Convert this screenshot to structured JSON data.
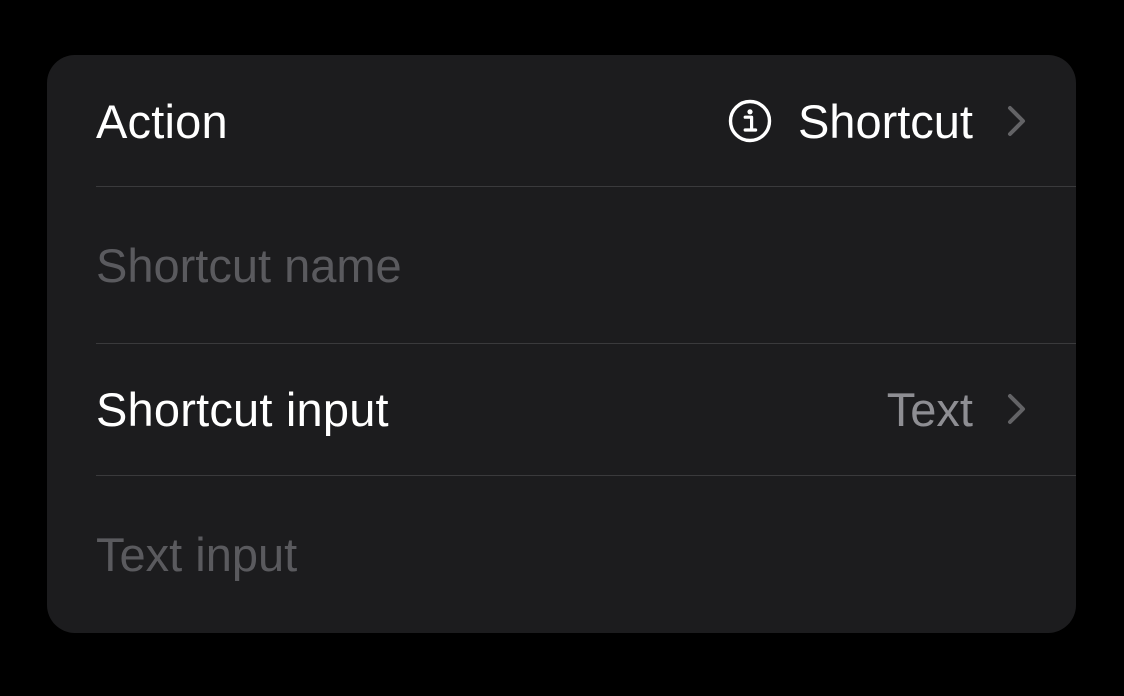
{
  "action_row": {
    "label": "Action",
    "value": "Shortcut",
    "info_icon": "info-circle-icon",
    "chevron_icon": "chevron-right-icon"
  },
  "shortcut_name_field": {
    "placeholder": "Shortcut name",
    "value": ""
  },
  "shortcut_input_row": {
    "label": "Shortcut input",
    "value": "Text",
    "chevron_icon": "chevron-right-icon"
  },
  "text_input_field": {
    "placeholder": "Text input",
    "value": ""
  },
  "colors": {
    "background": "#000000",
    "card": "#1c1c1e",
    "separator": "#3a3a3c",
    "primary_text": "#ffffff",
    "secondary_text": "#8e8e93",
    "placeholder_text": "#5a5a5e",
    "chevron": "#636366"
  }
}
